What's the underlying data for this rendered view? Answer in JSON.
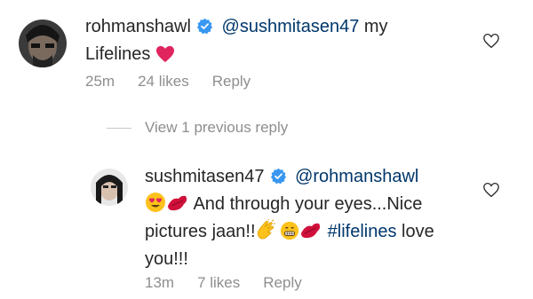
{
  "comment1": {
    "username": "rohmanshawl",
    "mention": "@sushmitasen47",
    "text_after_mention": " my",
    "text_line2": "Lifelines",
    "time": "25m",
    "likes": "24 likes",
    "reply": "Reply"
  },
  "thread": {
    "view_previous": "View 1 previous reply"
  },
  "comment2": {
    "username": "sushmitasen47",
    "mention": "@rohmanshawl",
    "line1_text": "And through your eyes...Nice",
    "line2_text": "pictures jaan!!",
    "hashtag": "#lifelines",
    "line2_after": " love",
    "line3_text": "you!!!",
    "time": "13m",
    "likes": "7 likes",
    "reply": "Reply"
  },
  "icons": {
    "verified": "verified-badge-icon",
    "like": "heart-outline-icon",
    "heart_emoji": "red-heart-emoji",
    "kiss_emoji": "kiss-mark-emoji",
    "hearteyes_emoji": "heart-eyes-emoji",
    "clap_emoji": "clapping-hands-emoji",
    "grin_emoji": "grinning-face-emoji"
  },
  "colors": {
    "verified_blue": "#3897f0",
    "mention_blue": "#00376b",
    "meta_gray": "#8e8e8e",
    "heart_red": "#e0245e"
  }
}
